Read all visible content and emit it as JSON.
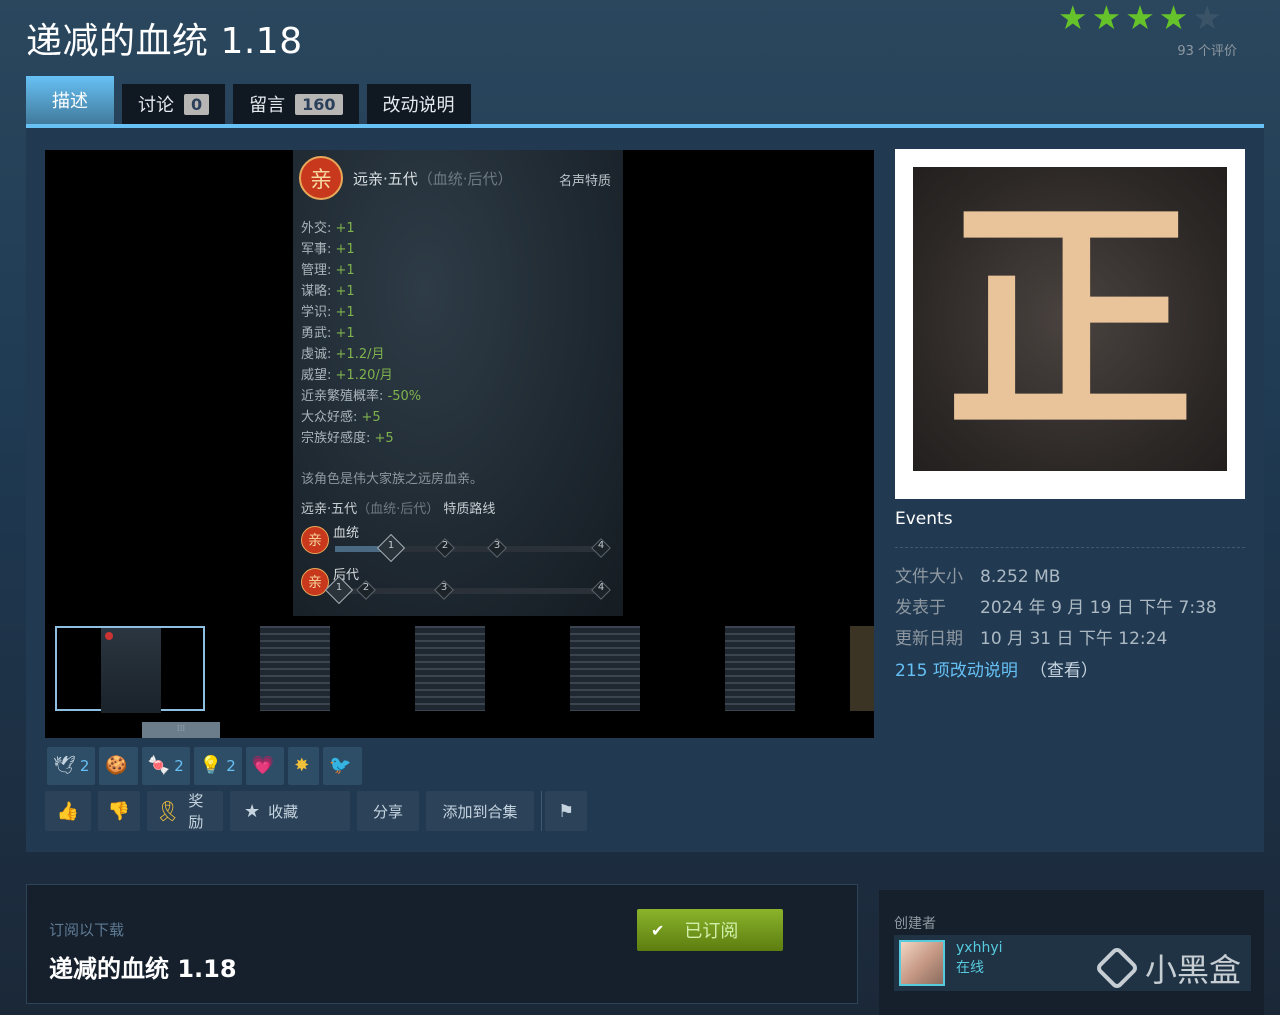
{
  "title": "递减的血统 1.18",
  "rating": {
    "stars_filled": 4,
    "stars_total": 5,
    "count_text": "93 个评价"
  },
  "tabs": [
    {
      "label": "描述"
    },
    {
      "label": "讨论",
      "count": "0"
    },
    {
      "label": "留言",
      "count": "160"
    },
    {
      "label": "改动说明"
    }
  ],
  "screenshot": {
    "badge": "亲",
    "title": "远亲·五代",
    "title_dim": "（血统·后代）",
    "fame": "名声特质",
    "stats": [
      {
        "label": "外交:",
        "value": "+1"
      },
      {
        "label": "军事:",
        "value": "+1"
      },
      {
        "label": "管理:",
        "value": "+1"
      },
      {
        "label": "谋略:",
        "value": "+1"
      },
      {
        "label": "学识:",
        "value": "+1"
      },
      {
        "label": "勇武:",
        "value": "+1"
      },
      {
        "label": "虔诚:",
        "value": "+1.2/月"
      },
      {
        "label": "威望:",
        "value": "+1.20/月"
      },
      {
        "label": "近亲繁殖概率:",
        "value": "-50%"
      },
      {
        "label": "大众好感:",
        "value": "+5"
      },
      {
        "label": "宗族好感度:",
        "value": "+5"
      }
    ],
    "desc": "该角色是伟大家族之远房血亲。",
    "route_title": "远亲·五代",
    "route_dim": "（血统·后代）",
    "route_suffix": "特质路线",
    "track1": {
      "label": "血统",
      "nodes": [
        "1",
        "2",
        "3",
        "4"
      ]
    },
    "track2": {
      "label": "后代",
      "nodes": [
        "1",
        "2",
        "3",
        "4"
      ]
    }
  },
  "preview": {
    "glyph": "正"
  },
  "events_label": "Events",
  "meta": {
    "size_label": "文件大小",
    "size": "8.252 MB",
    "posted_label": "发表于",
    "posted": "2024 年 9 月 19 日 下午 7:38",
    "updated_label": "更新日期",
    "updated": "10 月 31 日 下午 12:24"
  },
  "changes": {
    "link": "215 项改动说明",
    "view": "（查看）"
  },
  "awards": [
    {
      "icon": "🕊",
      "count": "2"
    },
    {
      "icon": "🍪",
      "count": ""
    },
    {
      "icon": "🍬",
      "count": "2"
    },
    {
      "icon": "💡",
      "count": "2"
    },
    {
      "icon": "💗",
      "count": ""
    },
    {
      "icon": "✸",
      "count": ""
    },
    {
      "icon": "🐦",
      "count": ""
    }
  ],
  "actions": {
    "award": "奖励",
    "favorite": "收藏",
    "share": "分享",
    "add_collection": "添加到合集"
  },
  "subscribe": {
    "label": "订阅以下载",
    "name": "递减的血统 1.18",
    "button": "已订阅"
  },
  "creator": {
    "title": "创建者",
    "name": "yxhhyi",
    "status": "在线"
  },
  "watermark": "小黑盒",
  "colors": {
    "accent": "#67c1f5",
    "star": "#66c22a",
    "subscribe": "#8bb32b"
  }
}
